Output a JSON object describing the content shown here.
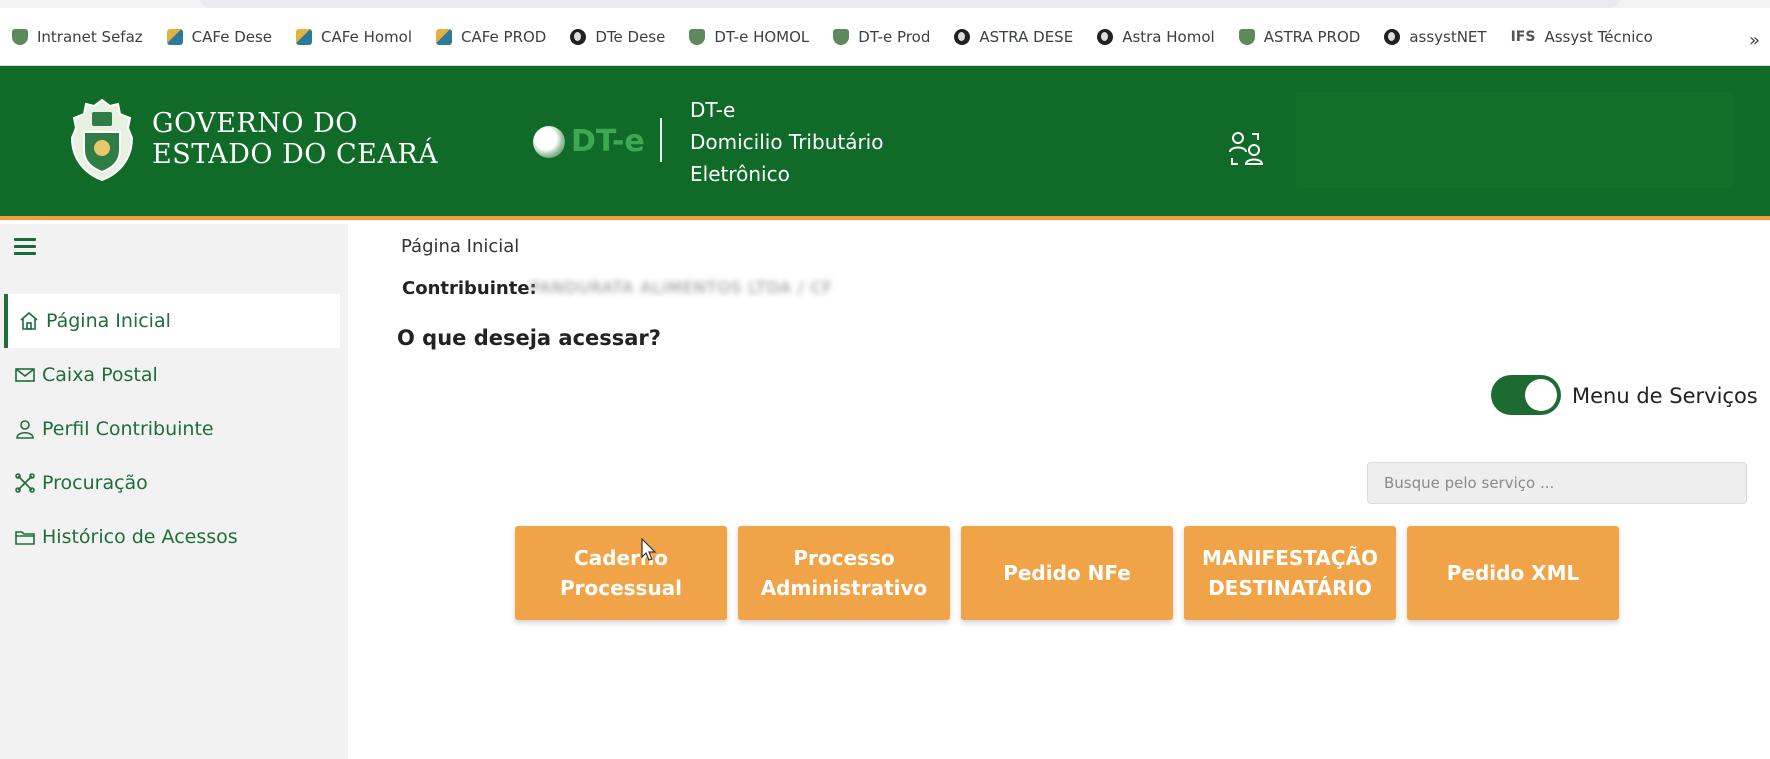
{
  "browser": {
    "bookmarks": [
      {
        "label": "Intranet Sefaz",
        "icon": "shield-icon"
      },
      {
        "label": "CAFe Dese",
        "icon": "cube-icon"
      },
      {
        "label": "CAFe Homol",
        "icon": "cube-icon"
      },
      {
        "label": "CAFe PROD",
        "icon": "cube-icon"
      },
      {
        "label": "DTe Dese",
        "icon": "globe-icon"
      },
      {
        "label": "DT-e HOMOL",
        "icon": "shield-icon"
      },
      {
        "label": "DT-e Prod",
        "icon": "shield-icon"
      },
      {
        "label": "ASTRA DESE",
        "icon": "globe-icon"
      },
      {
        "label": "Astra Homol",
        "icon": "globe-icon"
      },
      {
        "label": "ASTRA PROD",
        "icon": "shield-icon"
      },
      {
        "label": "assystNET",
        "icon": "globe-icon"
      },
      {
        "label": "Assyst Técnico",
        "icon": "ifs-icon",
        "icon_text": "IFS"
      }
    ],
    "more": "»"
  },
  "header": {
    "gov_line1": "GOVERNO DO",
    "gov_line2": "ESTADO DO CEARÁ",
    "dte_mark": "DT-e",
    "dte_line1": "DT-e",
    "dte_line2": "Domicilio Tributário",
    "dte_line3": "Eletrônico"
  },
  "sidebar": {
    "items": [
      {
        "label": "Página Inicial",
        "icon": "home-icon",
        "active": true
      },
      {
        "label": "Caixa Postal",
        "icon": "envelope-icon",
        "active": false
      },
      {
        "label": "Perfil Contribuinte",
        "icon": "user-icon",
        "active": false
      },
      {
        "label": "Procuração",
        "icon": "tools-icon",
        "active": false
      },
      {
        "label": "Histórico de Acessos",
        "icon": "folder-icon",
        "active": false
      }
    ]
  },
  "main": {
    "breadcrumb": "Página Inicial",
    "contribuinte_label": "Contribuinte:",
    "contribuinte_value": "PANDURATA ALIMENTOS LTDA / CF",
    "question": "O que deseja acessar?",
    "toggle_label": "Menu de Serviços",
    "toggle_on": true,
    "search_placeholder": "Busque pelo serviço ...",
    "tiles": [
      {
        "line1": "Caderno",
        "line2": "Processual"
      },
      {
        "line1": "Processo",
        "line2": "Administrativo"
      },
      {
        "line1": "Pedido NFe",
        "line2": ""
      },
      {
        "line1": "MANIFESTAÇÃO",
        "line2": "DESTINATÁRIO"
      },
      {
        "line1": "Pedido XML",
        "line2": ""
      }
    ]
  },
  "colors": {
    "header_green": "#116b28",
    "accent_orange": "#f29c38",
    "tile_orange": "#f1a347",
    "sidebar_text": "#1e6e3a"
  }
}
